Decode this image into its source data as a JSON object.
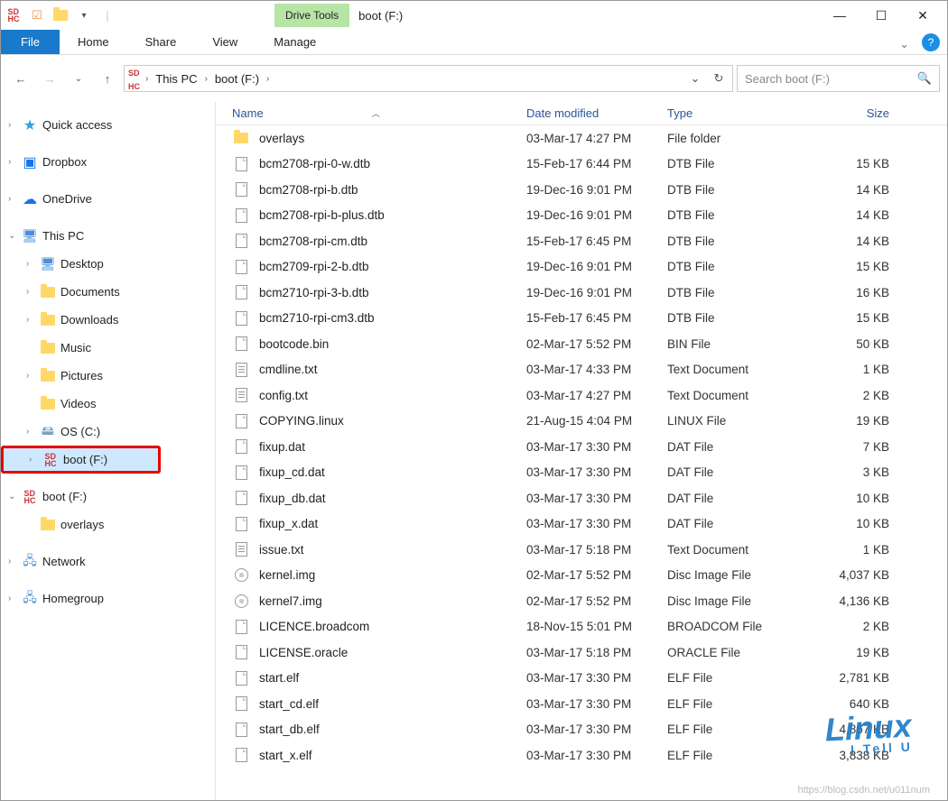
{
  "window": {
    "title": "boot (F:)",
    "drive_tools_label": "Drive Tools"
  },
  "ribbon": {
    "file": "File",
    "tabs": [
      "Home",
      "Share",
      "View",
      "Manage"
    ]
  },
  "nav": {
    "crumbs": [
      "This PC",
      "boot (F:)"
    ],
    "search_placeholder": "Search boot (F:)"
  },
  "tree": [
    {
      "label": "Quick access",
      "depth": 0,
      "exp": "›",
      "icon": "star"
    },
    {
      "label": "Dropbox",
      "depth": 0,
      "exp": "›",
      "icon": "box"
    },
    {
      "label": "OneDrive",
      "depth": 0,
      "exp": "›",
      "icon": "cloud"
    },
    {
      "label": "This PC",
      "depth": 0,
      "exp": "⌄",
      "icon": "pc"
    },
    {
      "label": "Desktop",
      "depth": 1,
      "exp": "›",
      "icon": "pc"
    },
    {
      "label": "Documents",
      "depth": 1,
      "exp": "›",
      "icon": "folder"
    },
    {
      "label": "Downloads",
      "depth": 1,
      "exp": "›",
      "icon": "folder"
    },
    {
      "label": "Music",
      "depth": 1,
      "exp": "",
      "icon": "folder"
    },
    {
      "label": "Pictures",
      "depth": 1,
      "exp": "›",
      "icon": "folder"
    },
    {
      "label": "Videos",
      "depth": 1,
      "exp": "",
      "icon": "folder"
    },
    {
      "label": "OS (C:)",
      "depth": 1,
      "exp": "›",
      "icon": "drive"
    },
    {
      "label": "boot (F:)",
      "depth": 1,
      "exp": "›",
      "icon": "sd",
      "highlight": true
    },
    {
      "label": "boot (F:)",
      "depth": 0,
      "exp": "⌄",
      "icon": "sd"
    },
    {
      "label": "overlays",
      "depth": 1,
      "exp": "",
      "icon": "folder"
    },
    {
      "label": "Network",
      "depth": 0,
      "exp": "›",
      "icon": "net"
    },
    {
      "label": "Homegroup",
      "depth": 0,
      "exp": "›",
      "icon": "net"
    }
  ],
  "columns": {
    "name": "Name",
    "date": "Date modified",
    "type": "Type",
    "size": "Size"
  },
  "files": [
    {
      "name": "overlays",
      "date": "03-Mar-17 4:27 PM",
      "type": "File folder",
      "size": "",
      "icon": "folder"
    },
    {
      "name": "bcm2708-rpi-0-w.dtb",
      "date": "15-Feb-17 6:44 PM",
      "type": "DTB File",
      "size": "15 KB",
      "icon": "file"
    },
    {
      "name": "bcm2708-rpi-b.dtb",
      "date": "19-Dec-16 9:01 PM",
      "type": "DTB File",
      "size": "14 KB",
      "icon": "file"
    },
    {
      "name": "bcm2708-rpi-b-plus.dtb",
      "date": "19-Dec-16 9:01 PM",
      "type": "DTB File",
      "size": "14 KB",
      "icon": "file"
    },
    {
      "name": "bcm2708-rpi-cm.dtb",
      "date": "15-Feb-17 6:45 PM",
      "type": "DTB File",
      "size": "14 KB",
      "icon": "file"
    },
    {
      "name": "bcm2709-rpi-2-b.dtb",
      "date": "19-Dec-16 9:01 PM",
      "type": "DTB File",
      "size": "15 KB",
      "icon": "file"
    },
    {
      "name": "bcm2710-rpi-3-b.dtb",
      "date": "19-Dec-16 9:01 PM",
      "type": "DTB File",
      "size": "16 KB",
      "icon": "file"
    },
    {
      "name": "bcm2710-rpi-cm3.dtb",
      "date": "15-Feb-17 6:45 PM",
      "type": "DTB File",
      "size": "15 KB",
      "icon": "file"
    },
    {
      "name": "bootcode.bin",
      "date": "02-Mar-17 5:52 PM",
      "type": "BIN File",
      "size": "50 KB",
      "icon": "file"
    },
    {
      "name": "cmdline.txt",
      "date": "03-Mar-17 4:33 PM",
      "type": "Text Document",
      "size": "1 KB",
      "icon": "txt"
    },
    {
      "name": "config.txt",
      "date": "03-Mar-17 4:27 PM",
      "type": "Text Document",
      "size": "2 KB",
      "icon": "txt"
    },
    {
      "name": "COPYING.linux",
      "date": "21-Aug-15 4:04 PM",
      "type": "LINUX File",
      "size": "19 KB",
      "icon": "file"
    },
    {
      "name": "fixup.dat",
      "date": "03-Mar-17 3:30 PM",
      "type": "DAT File",
      "size": "7 KB",
      "icon": "file"
    },
    {
      "name": "fixup_cd.dat",
      "date": "03-Mar-17 3:30 PM",
      "type": "DAT File",
      "size": "3 KB",
      "icon": "file"
    },
    {
      "name": "fixup_db.dat",
      "date": "03-Mar-17 3:30 PM",
      "type": "DAT File",
      "size": "10 KB",
      "icon": "file"
    },
    {
      "name": "fixup_x.dat",
      "date": "03-Mar-17 3:30 PM",
      "type": "DAT File",
      "size": "10 KB",
      "icon": "file"
    },
    {
      "name": "issue.txt",
      "date": "03-Mar-17 5:18 PM",
      "type": "Text Document",
      "size": "1 KB",
      "icon": "txt"
    },
    {
      "name": "kernel.img",
      "date": "02-Mar-17 5:52 PM",
      "type": "Disc Image File",
      "size": "4,037 KB",
      "icon": "img"
    },
    {
      "name": "kernel7.img",
      "date": "02-Mar-17 5:52 PM",
      "type": "Disc Image File",
      "size": "4,136 KB",
      "icon": "img"
    },
    {
      "name": "LICENCE.broadcom",
      "date": "18-Nov-15 5:01 PM",
      "type": "BROADCOM File",
      "size": "2 KB",
      "icon": "file"
    },
    {
      "name": "LICENSE.oracle",
      "date": "03-Mar-17 5:18 PM",
      "type": "ORACLE File",
      "size": "19 KB",
      "icon": "file"
    },
    {
      "name": "start.elf",
      "date": "03-Mar-17 3:30 PM",
      "type": "ELF File",
      "size": "2,781 KB",
      "icon": "file"
    },
    {
      "name": "start_cd.elf",
      "date": "03-Mar-17 3:30 PM",
      "type": "ELF File",
      "size": "640 KB",
      "icon": "file"
    },
    {
      "name": "start_db.elf",
      "date": "03-Mar-17 3:30 PM",
      "type": "ELF File",
      "size": "4,867 KB",
      "icon": "file"
    },
    {
      "name": "start_x.elf",
      "date": "03-Mar-17 3:30 PM",
      "type": "ELF File",
      "size": "3,838 KB",
      "icon": "file"
    }
  ],
  "watermark": {
    "main": "Linux",
    "sub": "I Tell U"
  },
  "attribution": "https://blog.csdn.net/u011num"
}
